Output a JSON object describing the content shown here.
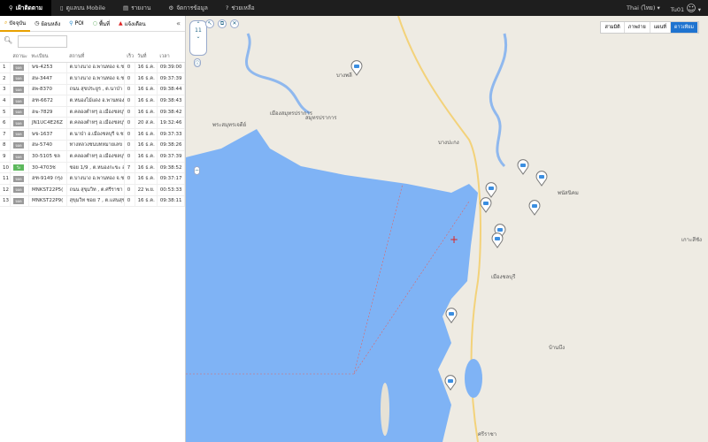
{
  "topbar": {
    "items": [
      {
        "label": "เฝ้าติดตาม",
        "icon": "map-pin-icon",
        "active": true
      },
      {
        "label": "ดูแลบน Mobile",
        "icon": "mobile-icon"
      },
      {
        "label": "รายงาน",
        "icon": "report-icon"
      },
      {
        "label": "จัดการข้อมูล",
        "icon": "gear-icon"
      },
      {
        "label": "ช่วยเหลือ",
        "icon": "help-icon"
      }
    ],
    "language": "Thai (ไทย)",
    "user": "Tu01"
  },
  "sidebar": {
    "tabs": [
      {
        "label": "ปัจจุบัน"
      },
      {
        "label": "ย้อนหลัง"
      },
      {
        "label": "POI"
      },
      {
        "label": "พื้นที่"
      },
      {
        "label": "แจ้งเตือน"
      }
    ],
    "columns": [
      "",
      "สถานะ",
      "ทะเบียน",
      "สถานที่",
      "เร็ว",
      "วันที่",
      "เวลา"
    ],
    "rows": [
      [
        "1",
        "จอด",
        "ษข-4253",
        "ต.บางนาง อ.พานทอง จ.ชลบุ",
        "0",
        "16 ธ.ค.",
        "09:39:00"
      ],
      [
        "2",
        "จอด",
        "ฮษ-3447",
        "ต.บางนาง อ.พานทอง จ.ชลบุ",
        "0",
        "16 ธ.ค.",
        "09:37:39"
      ],
      [
        "3",
        "จอด",
        "ฮพ-8370",
        "ถนน สุขประยูร , ต.นาป่า อ.เมื",
        "0",
        "16 ธ.ค.",
        "09:38:44"
      ],
      [
        "4",
        "จอด",
        "ฮฑ-6672",
        "ต.หนองไม้แดง อ.พานทอง จ.ชลบุ",
        "0",
        "16 ธ.ค.",
        "09:38:43"
      ],
      [
        "5",
        "จอด",
        "ฮฆ-7829",
        "ต.คลองตำหรุ อ.เมืองชลบุรี จ.",
        "0",
        "16 ธ.ค.",
        "09:38:42"
      ],
      [
        "6",
        "จอด",
        "JN1UC4E26Z",
        "ต.คลองตำหรุ อ.เมืองชลบุรี จ.",
        "0",
        "20 ส.ค.",
        "19:32:46"
      ],
      [
        "7",
        "จอด",
        "ษข-1637",
        "ต.นาป่า อ.เมืองชลบุรี จ.ชลบุ",
        "0",
        "16 ธ.ค.",
        "09:37:33"
      ],
      [
        "8",
        "จอด",
        "ฮษ-5740",
        "ทางหลวงชนบทหมายเลข , ต.บางโฉ",
        "0",
        "16 ธ.ค.",
        "09:38:26"
      ],
      [
        "9",
        "จอด",
        "30-5105 ชล",
        "ต.คลองตำหรุ อ.เมืองชลบุรี จ.",
        "0",
        "16 ธ.ค.",
        "09:37:39"
      ],
      [
        "10",
        "วิ่ง",
        "30-4703ช",
        "ซอย 1/9 , ต.หนองกะขะ อ.พ",
        "7",
        "16 ธ.ค.",
        "09:38:52"
      ],
      [
        "11",
        "จอด",
        "ฮฑ-9149 กรุง",
        "ต.บางนาง อ.พานทอง จ.ชลบุ",
        "0",
        "16 ธ.ค.",
        "09:37:17"
      ],
      [
        "12",
        "จอด",
        "MNKST22P5(",
        "ถนน สุขุมวิท , ต.ศรีราชา อ.ศ",
        "0",
        "22 พ.ย.",
        "00:53:33"
      ],
      [
        "13",
        "จอด",
        "MNKST22P9(",
        "สุขุมวิท ซอย 7 , ต.แสนสุข อ.",
        "0",
        "16 ธ.ค.",
        "09:38:11"
      ]
    ]
  },
  "map": {
    "types": [
      "ดาวเทียม",
      "แผนที่",
      "ภาพถ่าย",
      "สามมิติ"
    ],
    "active_type": "ดาวเทียม",
    "zoom_level": "11",
    "labels": [
      "สมุทรปราการ",
      "บางพลี",
      "เมืองสมุทรปราการ",
      "บางปะกง",
      "พระสมุทรเจดีย์",
      "เมืองชลบุรี",
      "ศรีราชา",
      "พนัสนิคม",
      "บ้านบึง",
      "เกาะสีชัง"
    ],
    "sea_color": "#7fb3f5",
    "land_color": "#eeebe3"
  }
}
